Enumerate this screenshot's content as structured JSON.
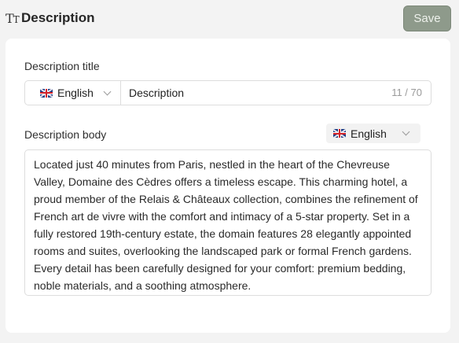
{
  "header": {
    "icon": "text-type-icon",
    "title": "Description",
    "save_label": "Save"
  },
  "title_field": {
    "label": "Description title",
    "language": "English",
    "value": "Description",
    "counter": "11 / 70"
  },
  "body_field": {
    "label": "Description body",
    "language": "English",
    "text": "Located just 40 minutes from Paris, nestled in the heart of the Chevreuse Valley, Domaine des Cèdres offers a timeless escape. This charming hotel, a proud member of the Relais & Châteaux collection, combines the refinement of French art de vivre with the comfort and intimacy of a 5-star property. Set in a fully restored 19th-century estate, the domain features 28 elegantly appointed rooms and suites, overlooking the landscaped park or formal French gardens. Every detail has been carefully designed for your comfort: premium bedding, noble materials, and a soothing atmosphere."
  },
  "colors": {
    "save_button": "#8e9a8b",
    "background": "#f3f3f3",
    "card": "#ffffff",
    "border": "#dddddd"
  }
}
